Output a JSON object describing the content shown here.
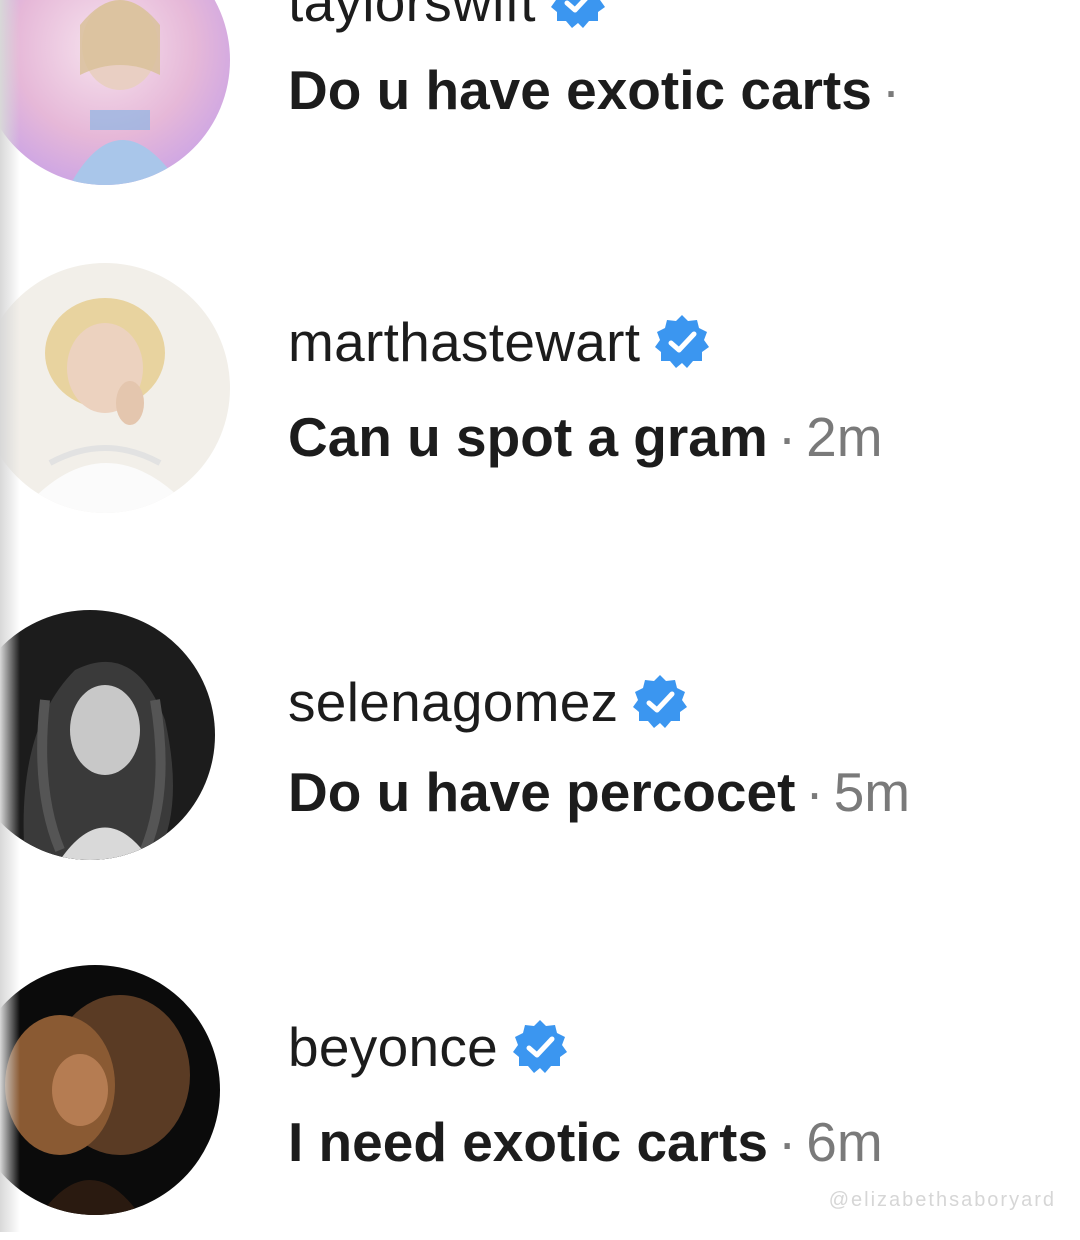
{
  "messages": [
    {
      "username": "taylorswift",
      "verified": true,
      "text": "Do u have exotic carts",
      "separator": "·",
      "time": "",
      "avatar_icon": "taylorswift-avatar"
    },
    {
      "username": "marthastewart",
      "verified": true,
      "text": "Can u spot a gram",
      "separator": "·",
      "time": "2m",
      "avatar_icon": "marthastewart-avatar"
    },
    {
      "username": "selenagomez",
      "verified": true,
      "text": "Do u have percocet",
      "separator": "·",
      "time": "5m",
      "avatar_icon": "selenagomez-avatar"
    },
    {
      "username": "beyonce",
      "verified": true,
      "text": "I need exotic carts",
      "separator": "·",
      "time": "6m",
      "avatar_icon": "beyonce-avatar"
    }
  ],
  "colors": {
    "verified_badge": "#3b96f0",
    "text": "#1c1c1c",
    "muted": "#7a7a7a",
    "background": "#ffffff"
  },
  "watermark": "@elizabethsaboryard"
}
